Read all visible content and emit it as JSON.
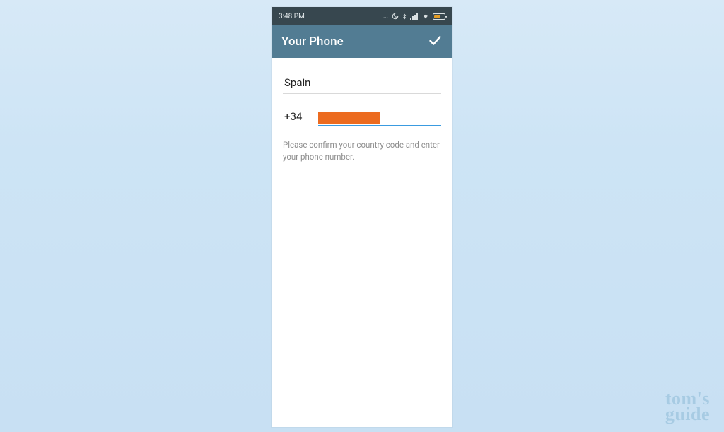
{
  "statusbar": {
    "time": "3:48 PM"
  },
  "appbar": {
    "title": "Your Phone"
  },
  "form": {
    "country": "Spain",
    "dial_code": "+34",
    "hint": "Please confirm your country code and enter your phone number."
  },
  "watermark": {
    "line1": "tom's",
    "line2": "guide"
  },
  "colors": {
    "appbar": "#527c93",
    "statusbar": "#37474f",
    "accent": "#3a9be0",
    "redaction": "#ec6b1f",
    "battery_fill": "#f4a623",
    "watermark": "#a7cbe3"
  }
}
